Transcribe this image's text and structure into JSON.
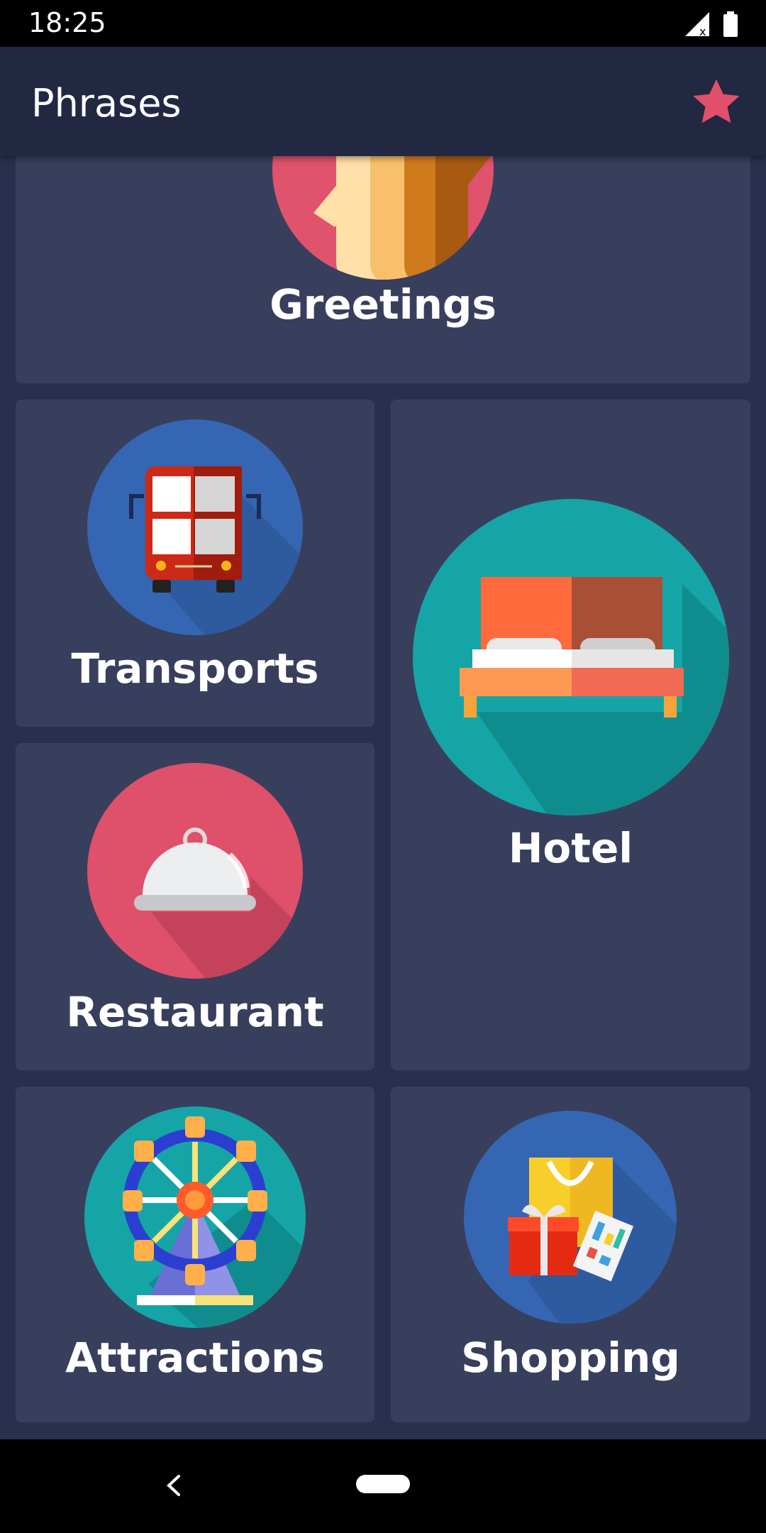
{
  "status": {
    "time": "18:25"
  },
  "app_bar": {
    "title": "Phrases",
    "favorite_icon": "star-icon",
    "accent": "#e0506a"
  },
  "categories": [
    {
      "label": "Greetings",
      "icon": "hands-icon"
    },
    {
      "label": "Transports",
      "icon": "bus-icon"
    },
    {
      "label": "Hotel",
      "icon": "bed-icon"
    },
    {
      "label": "Restaurant",
      "icon": "cloche-icon"
    },
    {
      "label": "Attractions",
      "icon": "ferris-wheel-icon"
    },
    {
      "label": "Shopping",
      "icon": "shopping-bag-icon"
    }
  ]
}
